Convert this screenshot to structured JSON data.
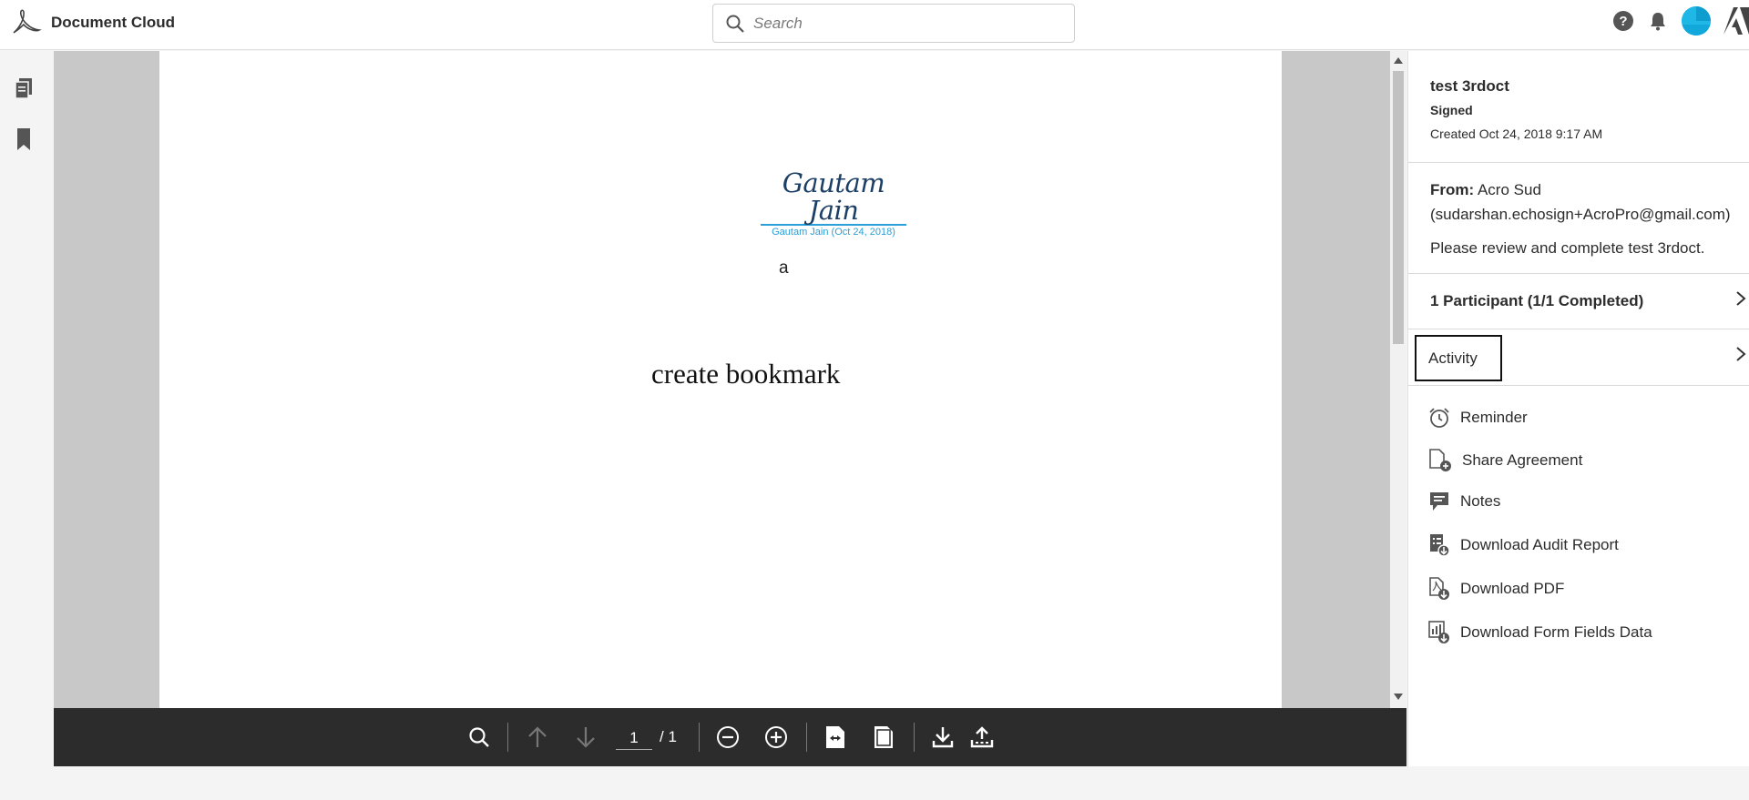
{
  "header": {
    "app_name": "Document Cloud",
    "search_placeholder": "Search"
  },
  "document": {
    "signature_name": "Gautam Jain",
    "signature_caption": "Gautam Jain (Oct 24, 2018)",
    "text_a": "a",
    "heading": "create bookmark"
  },
  "toolbar": {
    "current_page": "1",
    "page_total": "/ 1"
  },
  "panel": {
    "title": "test 3rdoct",
    "status": "Signed",
    "created": "Created Oct 24, 2018 9:17 AM",
    "from_label": "From:",
    "from_value": "Acro Sud (sudarshan.echosign+AcroPro@gmail.com)",
    "message": "Please review and complete test 3rdoct.",
    "participants": "1 Participant (1/1 Completed)",
    "activity": "Activity",
    "actions": [
      {
        "label": "Reminder",
        "icon": "alarm-clock-icon"
      },
      {
        "label": "Share Agreement",
        "icon": "share-document-icon"
      },
      {
        "label": "Notes",
        "icon": "notes-icon"
      },
      {
        "label": "Download Audit Report",
        "icon": "audit-report-icon"
      },
      {
        "label": "Download PDF",
        "icon": "pdf-download-icon"
      },
      {
        "label": "Download Form Fields Data",
        "icon": "form-data-icon"
      }
    ]
  },
  "colors": {
    "toolbar_bg": "#2c2c2c",
    "signature_accent": "#2a9fd8",
    "avatar": "#1fb7e6"
  }
}
